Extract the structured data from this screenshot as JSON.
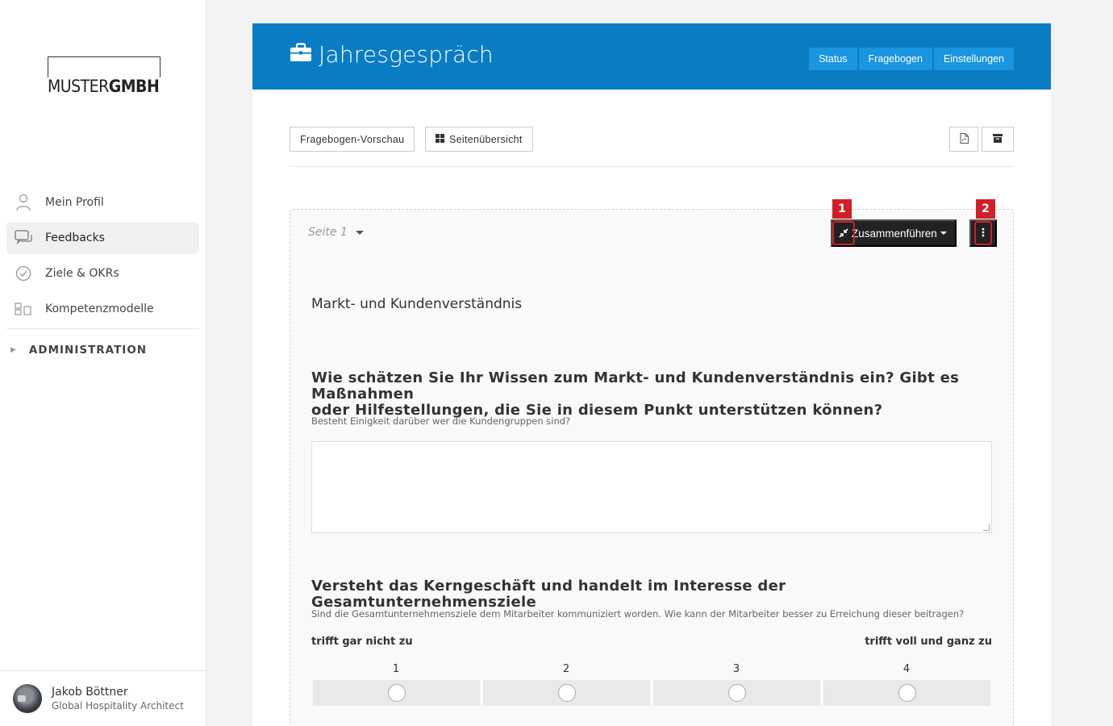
{
  "brand": {
    "left": "MUSTER",
    "right": "GMBH"
  },
  "sidebar": {
    "items": [
      {
        "label": "Mein Profil",
        "icon": "user-icon"
      },
      {
        "label": "Feedbacks",
        "icon": "chat-icon",
        "active": true
      },
      {
        "label": "Ziele & OKRs",
        "icon": "check-circle-icon"
      },
      {
        "label": "Kompetenzmodelle",
        "icon": "model-icon"
      }
    ],
    "admin_label": "ADMINISTRATION"
  },
  "user": {
    "name": "Jakob Böttner",
    "role": "Global Hospitality Architect"
  },
  "header": {
    "title": "Jahresgespräch",
    "tabs": [
      "Status",
      "Fragebogen",
      "Einstellungen"
    ],
    "accent": "#0a7cc4",
    "tab_color": "#1a95e0"
  },
  "toolbar": {
    "preview_label": "Fragebogen-Vorschau",
    "overview_label": "Seitenübersicht"
  },
  "page": {
    "label": "Seite 1",
    "merge_label": "Zusammenführen",
    "markers": [
      "1",
      "2"
    ],
    "section_title": "Markt- und Kundenverständnis",
    "question1": {
      "title_line1": "Wie schätzen Sie Ihr Wissen zum Markt- und Kundenverständnis ein? Gibt es Maßnahmen",
      "title_line2": "oder Hilfestellungen, die Sie in diesem Punkt unterstützen können?",
      "hint": "Besteht Einigkeit darüber wer die Kundengruppen sind?"
    },
    "question2": {
      "title": "Versteht das Kerngeschäft und handelt im Interesse der Gesamtunternehmensziele",
      "hint": "Sind die Gesamtunternehmensziele dem Mitarbeiter kommuniziert worden. Wie kann der Mitarbeiter besser zu Erreichung dieser beitragen?",
      "scale_min_label": "trifft gar nicht zu",
      "scale_max_label": "trifft voll und ganz zu",
      "scale": [
        "1",
        "2",
        "3",
        "4"
      ]
    }
  }
}
